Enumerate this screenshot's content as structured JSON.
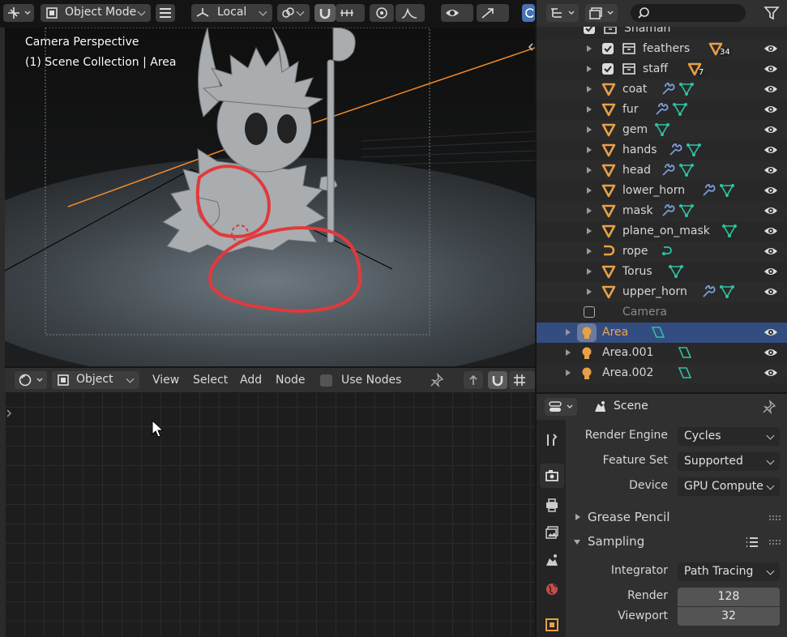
{
  "viewport": {
    "mode": "Object Mode",
    "orientation": "Local",
    "overlay_line1": "Camera Perspective",
    "overlay_line2": "(1) Scene Collection | Area"
  },
  "node_editor": {
    "type": "Object",
    "menus": [
      "View",
      "Select",
      "Add",
      "Node"
    ],
    "use_nodes_label": "Use Nodes",
    "use_nodes_checked": false
  },
  "outliner": {
    "search_placeholder": "",
    "rows": [
      {
        "name": "Shaman",
        "kind": "collection",
        "checked": true,
        "visible": false
      },
      {
        "name": "feathers",
        "kind": "collection",
        "checked": true,
        "badge": "34",
        "visible": true
      },
      {
        "name": "staff",
        "kind": "collection",
        "checked": true,
        "badge": "7",
        "visible": true
      },
      {
        "name": "coat",
        "kind": "mesh",
        "modifier": true,
        "visible": true
      },
      {
        "name": "fur",
        "kind": "mesh",
        "modifier": true,
        "visible": true
      },
      {
        "name": "gem",
        "kind": "mesh",
        "modifier": false,
        "visible": true
      },
      {
        "name": "hands",
        "kind": "mesh",
        "modifier": true,
        "visible": true
      },
      {
        "name": "head",
        "kind": "mesh",
        "modifier": true,
        "visible": true
      },
      {
        "name": "lower_horn",
        "kind": "mesh",
        "modifier": true,
        "visible": true
      },
      {
        "name": "mask",
        "kind": "mesh",
        "modifier": true,
        "visible": true
      },
      {
        "name": "plane_on_mask",
        "kind": "mesh",
        "modifier": false,
        "visible": true
      },
      {
        "name": "rope",
        "kind": "curve",
        "modifier": false,
        "visible": true
      },
      {
        "name": "Torus",
        "kind": "mesh",
        "modifier": false,
        "visible": true
      },
      {
        "name": "upper_horn",
        "kind": "mesh",
        "modifier": true,
        "visible": true
      },
      {
        "name": "Camera",
        "kind": "collection-off",
        "checked": false,
        "visible": false
      },
      {
        "name": "Area",
        "kind": "light",
        "selected": true,
        "visible": true
      },
      {
        "name": "Area.001",
        "kind": "light",
        "visible": true
      },
      {
        "name": "Area.002",
        "kind": "light",
        "visible": true
      }
    ]
  },
  "properties": {
    "context": "Scene",
    "render_engine_label": "Render Engine",
    "render_engine": "Cycles",
    "feature_set_label": "Feature Set",
    "feature_set": "Supported",
    "device_label": "Device",
    "device": "GPU Compute",
    "panel_grease_pencil": "Grease Pencil",
    "panel_sampling": "Sampling",
    "integrator_label": "Integrator",
    "integrator": "Path Tracing",
    "render_label": "Render",
    "render_samples": "128",
    "viewport_label": "Viewport",
    "viewport_samples": "32"
  },
  "colors": {
    "selected_row": "#334d80",
    "mesh_icon": "#e8a046",
    "modifier_icon": "#7b9cd8",
    "data_icon": "#2fc2a3",
    "annotation_red": "#e2393d",
    "camera_line": "#f08a2c"
  }
}
